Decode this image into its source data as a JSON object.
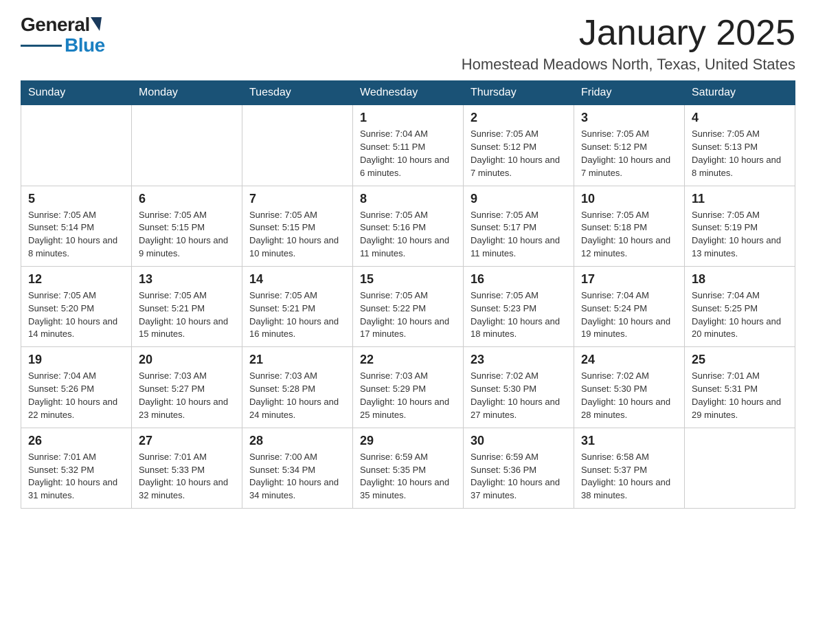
{
  "header": {
    "logo_general": "General",
    "logo_blue": "Blue",
    "month_title": "January 2025",
    "location": "Homestead Meadows North, Texas, United States"
  },
  "calendar": {
    "days_of_week": [
      "Sunday",
      "Monday",
      "Tuesday",
      "Wednesday",
      "Thursday",
      "Friday",
      "Saturday"
    ],
    "weeks": [
      [
        {
          "day": "",
          "info": ""
        },
        {
          "day": "",
          "info": ""
        },
        {
          "day": "",
          "info": ""
        },
        {
          "day": "1",
          "info": "Sunrise: 7:04 AM\nSunset: 5:11 PM\nDaylight: 10 hours and 6 minutes."
        },
        {
          "day": "2",
          "info": "Sunrise: 7:05 AM\nSunset: 5:12 PM\nDaylight: 10 hours and 7 minutes."
        },
        {
          "day": "3",
          "info": "Sunrise: 7:05 AM\nSunset: 5:12 PM\nDaylight: 10 hours and 7 minutes."
        },
        {
          "day": "4",
          "info": "Sunrise: 7:05 AM\nSunset: 5:13 PM\nDaylight: 10 hours and 8 minutes."
        }
      ],
      [
        {
          "day": "5",
          "info": "Sunrise: 7:05 AM\nSunset: 5:14 PM\nDaylight: 10 hours and 8 minutes."
        },
        {
          "day": "6",
          "info": "Sunrise: 7:05 AM\nSunset: 5:15 PM\nDaylight: 10 hours and 9 minutes."
        },
        {
          "day": "7",
          "info": "Sunrise: 7:05 AM\nSunset: 5:15 PM\nDaylight: 10 hours and 10 minutes."
        },
        {
          "day": "8",
          "info": "Sunrise: 7:05 AM\nSunset: 5:16 PM\nDaylight: 10 hours and 11 minutes."
        },
        {
          "day": "9",
          "info": "Sunrise: 7:05 AM\nSunset: 5:17 PM\nDaylight: 10 hours and 11 minutes."
        },
        {
          "day": "10",
          "info": "Sunrise: 7:05 AM\nSunset: 5:18 PM\nDaylight: 10 hours and 12 minutes."
        },
        {
          "day": "11",
          "info": "Sunrise: 7:05 AM\nSunset: 5:19 PM\nDaylight: 10 hours and 13 minutes."
        }
      ],
      [
        {
          "day": "12",
          "info": "Sunrise: 7:05 AM\nSunset: 5:20 PM\nDaylight: 10 hours and 14 minutes."
        },
        {
          "day": "13",
          "info": "Sunrise: 7:05 AM\nSunset: 5:21 PM\nDaylight: 10 hours and 15 minutes."
        },
        {
          "day": "14",
          "info": "Sunrise: 7:05 AM\nSunset: 5:21 PM\nDaylight: 10 hours and 16 minutes."
        },
        {
          "day": "15",
          "info": "Sunrise: 7:05 AM\nSunset: 5:22 PM\nDaylight: 10 hours and 17 minutes."
        },
        {
          "day": "16",
          "info": "Sunrise: 7:05 AM\nSunset: 5:23 PM\nDaylight: 10 hours and 18 minutes."
        },
        {
          "day": "17",
          "info": "Sunrise: 7:04 AM\nSunset: 5:24 PM\nDaylight: 10 hours and 19 minutes."
        },
        {
          "day": "18",
          "info": "Sunrise: 7:04 AM\nSunset: 5:25 PM\nDaylight: 10 hours and 20 minutes."
        }
      ],
      [
        {
          "day": "19",
          "info": "Sunrise: 7:04 AM\nSunset: 5:26 PM\nDaylight: 10 hours and 22 minutes."
        },
        {
          "day": "20",
          "info": "Sunrise: 7:03 AM\nSunset: 5:27 PM\nDaylight: 10 hours and 23 minutes."
        },
        {
          "day": "21",
          "info": "Sunrise: 7:03 AM\nSunset: 5:28 PM\nDaylight: 10 hours and 24 minutes."
        },
        {
          "day": "22",
          "info": "Sunrise: 7:03 AM\nSunset: 5:29 PM\nDaylight: 10 hours and 25 minutes."
        },
        {
          "day": "23",
          "info": "Sunrise: 7:02 AM\nSunset: 5:30 PM\nDaylight: 10 hours and 27 minutes."
        },
        {
          "day": "24",
          "info": "Sunrise: 7:02 AM\nSunset: 5:30 PM\nDaylight: 10 hours and 28 minutes."
        },
        {
          "day": "25",
          "info": "Sunrise: 7:01 AM\nSunset: 5:31 PM\nDaylight: 10 hours and 29 minutes."
        }
      ],
      [
        {
          "day": "26",
          "info": "Sunrise: 7:01 AM\nSunset: 5:32 PM\nDaylight: 10 hours and 31 minutes."
        },
        {
          "day": "27",
          "info": "Sunrise: 7:01 AM\nSunset: 5:33 PM\nDaylight: 10 hours and 32 minutes."
        },
        {
          "day": "28",
          "info": "Sunrise: 7:00 AM\nSunset: 5:34 PM\nDaylight: 10 hours and 34 minutes."
        },
        {
          "day": "29",
          "info": "Sunrise: 6:59 AM\nSunset: 5:35 PM\nDaylight: 10 hours and 35 minutes."
        },
        {
          "day": "30",
          "info": "Sunrise: 6:59 AM\nSunset: 5:36 PM\nDaylight: 10 hours and 37 minutes."
        },
        {
          "day": "31",
          "info": "Sunrise: 6:58 AM\nSunset: 5:37 PM\nDaylight: 10 hours and 38 minutes."
        },
        {
          "day": "",
          "info": ""
        }
      ]
    ]
  }
}
